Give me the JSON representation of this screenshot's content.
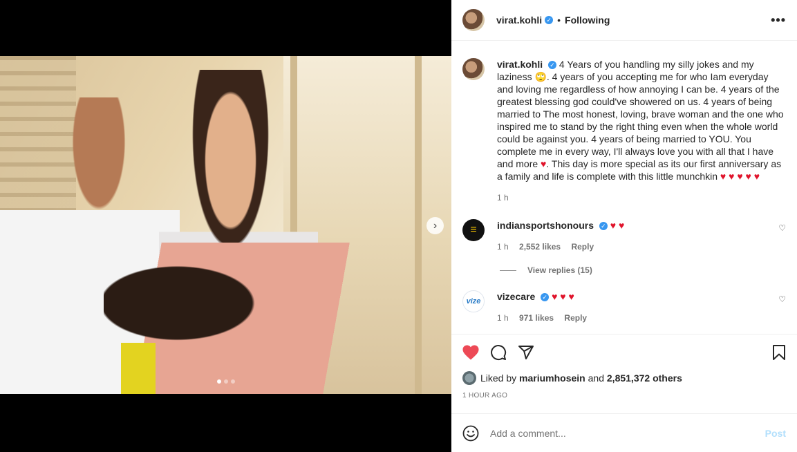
{
  "post": {
    "username": "virat.kohli",
    "follow_status": "Following",
    "separator": "•",
    "more_label": "•••",
    "carousel_next": "›"
  },
  "caption": {
    "username": "virat.kohli",
    "text_part1": "4 Years of you handling my silly jokes and my laziness 🙄. 4 years of you accepting me for who Iam everyday and loving me regardless of how annoying I can be. 4 years of the greatest blessing god could've showered on us. 4 years of being married to The most honest, loving, brave woman and the one who inspired me to stand by the right thing even when the whole world could be against you. 4 years of being married to YOU. You complete me in every way, I'll always love you with all that I have and more ",
    "heart1": "♥",
    "text_part2": ". This day is more special as its our first anniversary as a family and life is complete with this little munchkin ",
    "hearts_end": "♥ ♥ ♥ ♥ ♥",
    "time": "1 h"
  },
  "comments": [
    {
      "username": "indiansportshonours",
      "text": "♥ ♥",
      "time": "1 h",
      "likes": "2,552 likes",
      "reply": "Reply",
      "view_replies": "View replies (15)",
      "avatar_letter": "≡"
    },
    {
      "username": "vizecare",
      "text": "♥ ♥ ♥",
      "time": "1 h",
      "likes": "971 likes",
      "reply": "Reply",
      "avatar_letter": "vize"
    }
  ],
  "likes": {
    "prefix": "Liked by",
    "user": "mariumhosein",
    "and": "and",
    "others": "2,851,372 others"
  },
  "posted_time": "1 HOUR AGO",
  "add_comment": {
    "placeholder": "Add a comment...",
    "post_label": "Post"
  },
  "carousel": {
    "current": 1,
    "total": 3
  },
  "colors": {
    "like_active": "#ed4956",
    "verified": "#3897f0",
    "post_disabled": "#b2dffc"
  }
}
